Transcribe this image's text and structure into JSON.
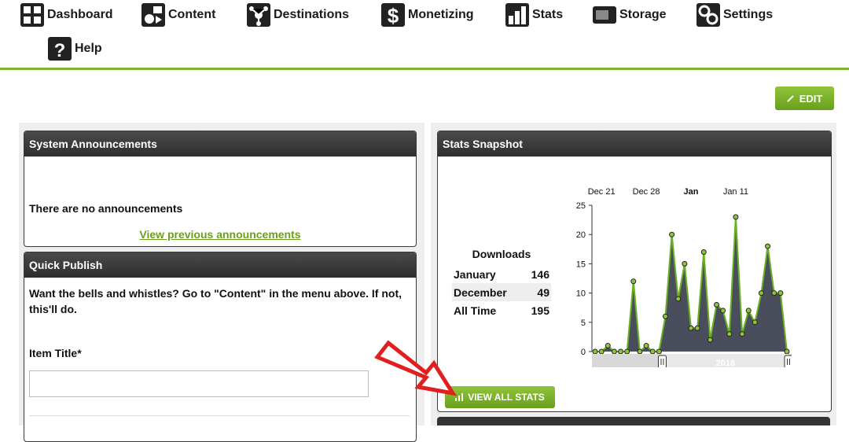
{
  "nav": {
    "items": [
      {
        "label": "Dashboard",
        "icon": "dashboard-grid-icon"
      },
      {
        "label": "Content",
        "icon": "content-media-icon"
      },
      {
        "label": "Destinations",
        "icon": "destinations-network-icon"
      },
      {
        "label": "Monetizing",
        "icon": "dollar-icon"
      },
      {
        "label": "Stats",
        "icon": "bar-stats-icon"
      },
      {
        "label": "Storage",
        "icon": "storage-drive-icon"
      },
      {
        "label": "Settings",
        "icon": "gears-icon"
      },
      {
        "label": "Help",
        "icon": "question-icon"
      }
    ],
    "accent": "#7fb32a"
  },
  "edit_label": "EDIT",
  "announcements": {
    "title": "System Announcements",
    "empty_text": "There are no announcements",
    "link_text": "View previous announcements"
  },
  "quick_publish": {
    "title": "Quick Publish",
    "intro": "Want the bells and whistles? Go to \"Content\" in the menu above. If not, this'll do.",
    "item_title_label": "Item Title*",
    "item_title_value": ""
  },
  "stats": {
    "title": "Stats Snapshot",
    "downloads_header": "Downloads",
    "rows": [
      {
        "label": "January",
        "value": "146"
      },
      {
        "label": "December",
        "value": "49"
      },
      {
        "label": "All Time",
        "value": "195"
      }
    ],
    "view_all_label": "VIEW ALL STATS",
    "navigator_year": "2018"
  },
  "chart_data": {
    "type": "area",
    "x_tick_labels": [
      "Dec 21",
      "Dec 28",
      "Jan",
      "Jan 11"
    ],
    "y_ticks": [
      0,
      5,
      10,
      15,
      20,
      25
    ],
    "ylim": [
      0,
      25
    ],
    "series": [
      {
        "values": [
          0,
          0,
          1,
          0,
          0,
          0,
          12,
          0,
          1,
          0,
          0,
          6,
          20,
          9,
          15,
          4,
          4,
          17,
          2,
          8,
          7,
          3,
          23,
          3,
          7,
          5,
          10,
          18,
          10,
          10,
          0
        ]
      }
    ],
    "colors": {
      "fill": "#4a4d5c",
      "line": "#6ab023",
      "point": "#8fc43a"
    }
  }
}
